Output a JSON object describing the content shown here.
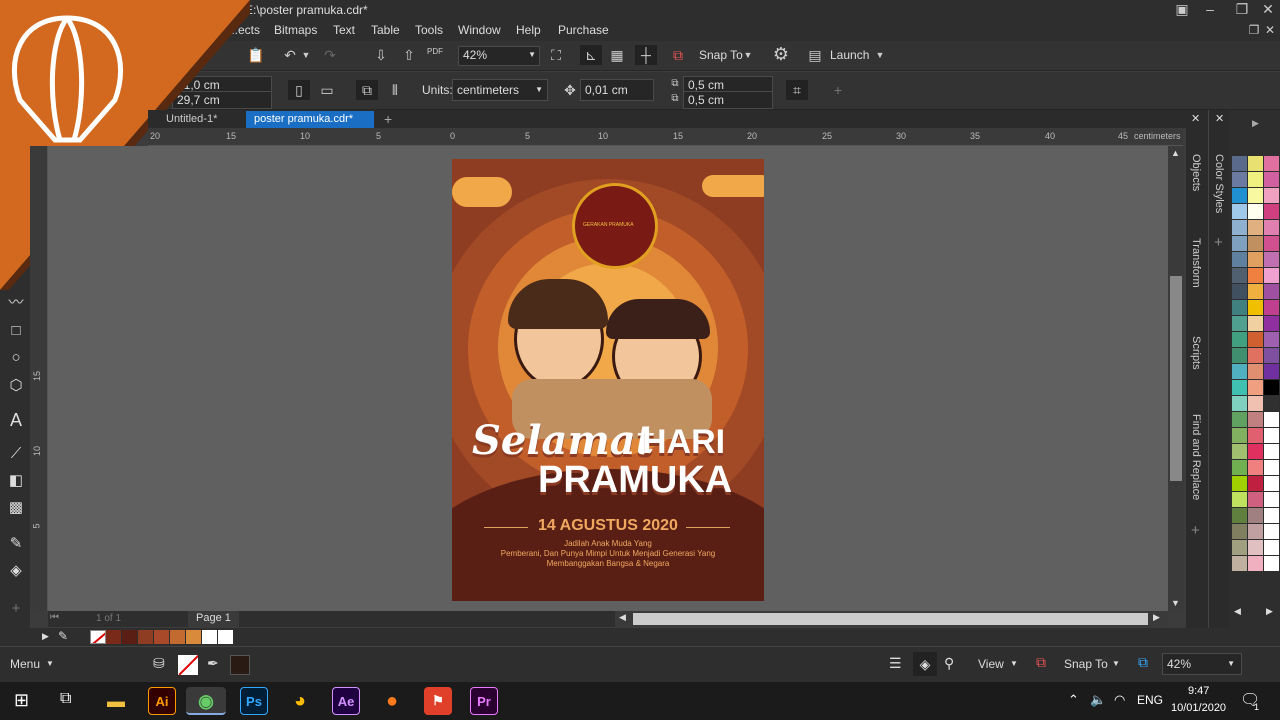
{
  "window": {
    "title": "E:\\poster pramuka.cdr*"
  },
  "menu": [
    "...ects",
    "Bitmaps",
    "Text",
    "Table",
    "Tools",
    "Window",
    "Help",
    "Purchase"
  ],
  "toolbar": {
    "zoom": "42%",
    "snap_to": "Snap To",
    "launch": "Launch",
    "pdf": "PDF"
  },
  "property_bar": {
    "width": "21,0 cm",
    "height": "29,7 cm",
    "units_label": "Units:",
    "units": "centimeters",
    "nudge": "0,01 cm",
    "dup_x": "0,5 cm",
    "dup_y": "0,5 cm"
  },
  "tabs": [
    {
      "label": "Untitled-1*"
    },
    {
      "label": "poster pramuka.cdr*"
    }
  ],
  "ruler": {
    "h_labels": [
      "20",
      "15",
      "10",
      "5",
      "0",
      "5",
      "10",
      "15",
      "20",
      "25",
      "30",
      "35",
      "40",
      "45"
    ],
    "unit": "centimeters",
    "v_labels": [
      "5",
      "10",
      "15"
    ]
  },
  "poster": {
    "title1": "Selamat",
    "title2": "HARI",
    "title3": "PRAMUKA",
    "date": "14 AGUSTUS 2020",
    "line1": "Jadilah Anak Muda Yang",
    "line2": "Pemberani, Dan Punya Mimpi Untuk Menjadi Generasi Yang",
    "line3": "Membanggakan Bangsa & Negara",
    "badge": "GERAKAN PRAMUKA"
  },
  "pagebar": {
    "page_count": "1 of 1",
    "page_tab": "Page 1"
  },
  "dockers": [
    "Objects",
    "Transform",
    "Scripts",
    "Find and Replace",
    "Color Styles"
  ],
  "document_palette": [
    "#7a2a18",
    "#5a1e14",
    "#8f3d22",
    "#a84a2a",
    "#c26a30",
    "#d98a3a",
    "#ffffff",
    "#ffffff"
  ],
  "palette": [
    "#5a6a8a",
    "#e8e070",
    "#e070a0",
    "#6a7aa0",
    "#f0f080",
    "#d060a0",
    "#2090d0",
    "#f8f8a0",
    "#f0a0c0",
    "#a0c8e8",
    "#fffff0",
    "#d04080",
    "#90b0d0",
    "#e0b080",
    "#e080b0",
    "#80a0c0",
    "#c09060",
    "#d05090",
    "#6080a0",
    "#e0a060",
    "#c070b0",
    "#506070",
    "#f08040",
    "#f0a0d0",
    "#405060",
    "#f0b040",
    "#a050a0",
    "#408080",
    "#f0c000",
    "#c04090",
    "#50a090",
    "#f0d0a0",
    "#9030a0",
    "#40a080",
    "#d06030",
    "#a060b0",
    "#409070",
    "#e07060",
    "#8050a0",
    "#50b0c0",
    "#e09070",
    "#7030a0",
    "#40c0b0",
    "#f0a080",
    "#000000",
    "#80d0c0",
    "#f0c0b0",
    "#303030",
    "#60a060",
    "#c08080",
    "#ffffff",
    "#80b060",
    "#e06070",
    "#ffffff",
    "#a0c070",
    "#e03060",
    "#ffffff",
    "#70b050",
    "#f08080",
    "#ffffff",
    "#a0d000",
    "#c02040",
    "#ffffff",
    "#c0e060",
    "#d06080",
    "#ffffff",
    "#608040",
    "#a08080",
    "#ffffff",
    "#808060",
    "#c0a0a0",
    "#ffffff",
    "#a0a080",
    "#e0c0c0",
    "#ffffff",
    "#c0b0a0",
    "#f0b0c0",
    "#ffffff"
  ],
  "statusbar": {
    "menu": "Menu",
    "view": "View",
    "snap_to": "Snap To",
    "zoom": "42%"
  },
  "taskbar": {
    "lang": "ENG",
    "time": "9:47",
    "date": "10/01/2020",
    "notif": "1",
    "apps": [
      {
        "label": "Ai",
        "color": "#ff9a00",
        "bg": "#330000"
      },
      {
        "label": "Ps",
        "color": "#31a8ff",
        "bg": "#001e36"
      },
      {
        "label": "Ae",
        "color": "#d291ff",
        "bg": "#1f0040"
      },
      {
        "label": "Pr",
        "color": "#ea77ff",
        "bg": "#2a0030"
      }
    ]
  }
}
